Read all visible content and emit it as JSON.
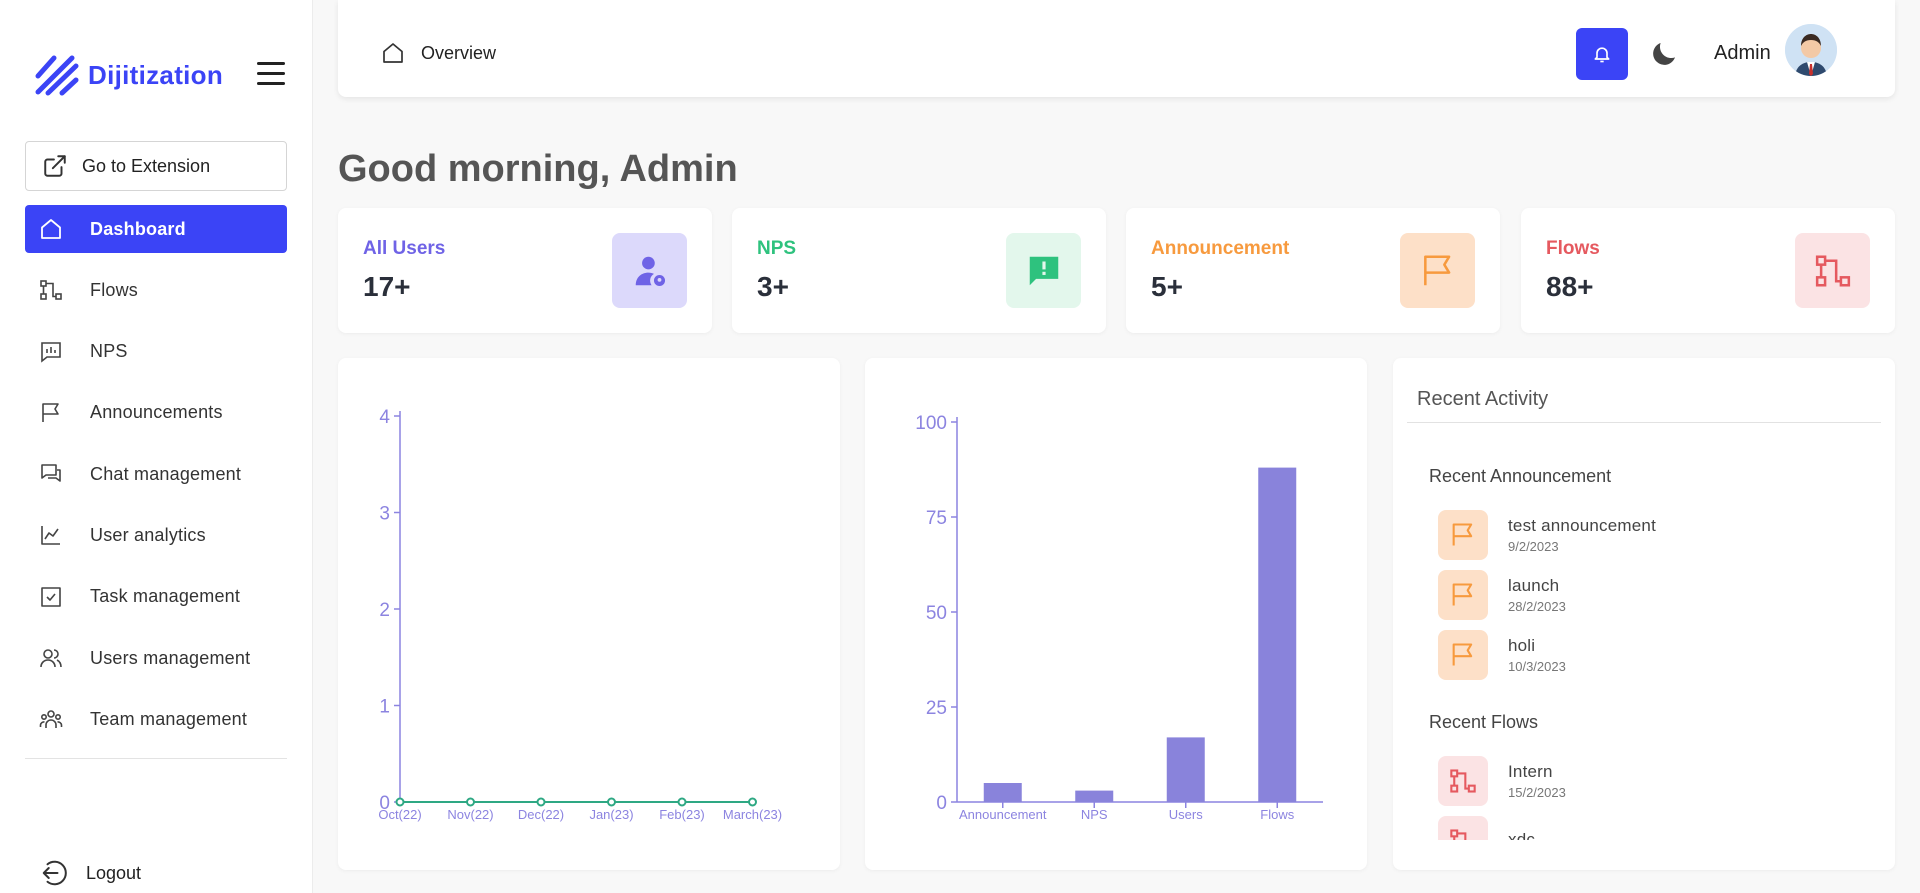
{
  "app": {
    "brand": "Dijitization"
  },
  "sidebar": {
    "extension_label": "Go to Extension",
    "items": [
      {
        "label": "Dashboard",
        "icon": "home-icon",
        "active": true
      },
      {
        "label": "Flows",
        "icon": "flow-icon"
      },
      {
        "label": "NPS",
        "icon": "nps-icon"
      },
      {
        "label": "Announcements",
        "icon": "flag-icon"
      },
      {
        "label": "Chat management",
        "icon": "chat-icon"
      },
      {
        "label": "User analytics",
        "icon": "analytics-icon"
      },
      {
        "label": "Task management",
        "icon": "task-icon"
      },
      {
        "label": "Users management",
        "icon": "users-icon"
      },
      {
        "label": "Team management",
        "icon": "team-icon"
      }
    ],
    "logout_label": "Logout"
  },
  "header": {
    "breadcrumb": "Overview",
    "user_name": "Admin"
  },
  "greeting": "Good morning, Admin",
  "stats": [
    {
      "title": "All Users",
      "value": "17+",
      "color": "#6f63e6",
      "bg": "#dcd9fb",
      "icon": "user-pin-icon"
    },
    {
      "title": "NPS",
      "value": "3+",
      "color": "#2ec27e",
      "bg": "#e3f7ec",
      "icon": "feedback-icon"
    },
    {
      "title": "Announcement",
      "value": "5+",
      "color": "#f79a3e",
      "bg": "#fde0c8",
      "icon": "flag-icon"
    },
    {
      "title": "Flows",
      "value": "88+",
      "color": "#e5595f",
      "bg": "#fbe3e4",
      "icon": "flow-icon"
    }
  ],
  "chart_data": [
    {
      "type": "line",
      "categories": [
        "Oct(22)",
        "Nov(22)",
        "Dec(22)",
        "Jan(23)",
        "Feb(23)",
        "March(23)"
      ],
      "values": [
        0,
        0,
        0,
        0,
        0,
        0
      ],
      "yticks": [
        0,
        1,
        2,
        3,
        4
      ],
      "ylim": [
        0,
        4
      ],
      "line_color": "#2ea883",
      "axis_color": "#8c84e0"
    },
    {
      "type": "bar",
      "categories": [
        "Announcement",
        "NPS",
        "Users",
        "Flows"
      ],
      "values": [
        5,
        3,
        17,
        88
      ],
      "yticks": [
        0,
        25,
        50,
        75,
        100
      ],
      "ylim": [
        0,
        100
      ],
      "bar_color": "#8983db",
      "axis_color": "#8c84e0"
    }
  ],
  "activity": {
    "title": "Recent Activity",
    "announcements_title": "Recent Announcement",
    "announcements": [
      {
        "name": "test announcement",
        "date": "9/2/2023"
      },
      {
        "name": "launch",
        "date": "28/2/2023"
      },
      {
        "name": "holi",
        "date": "10/3/2023"
      }
    ],
    "flows_title": "Recent Flows",
    "flows": [
      {
        "name": "Intern",
        "date": "15/2/2023"
      },
      {
        "name": "xdc",
        "date": ""
      }
    ]
  }
}
